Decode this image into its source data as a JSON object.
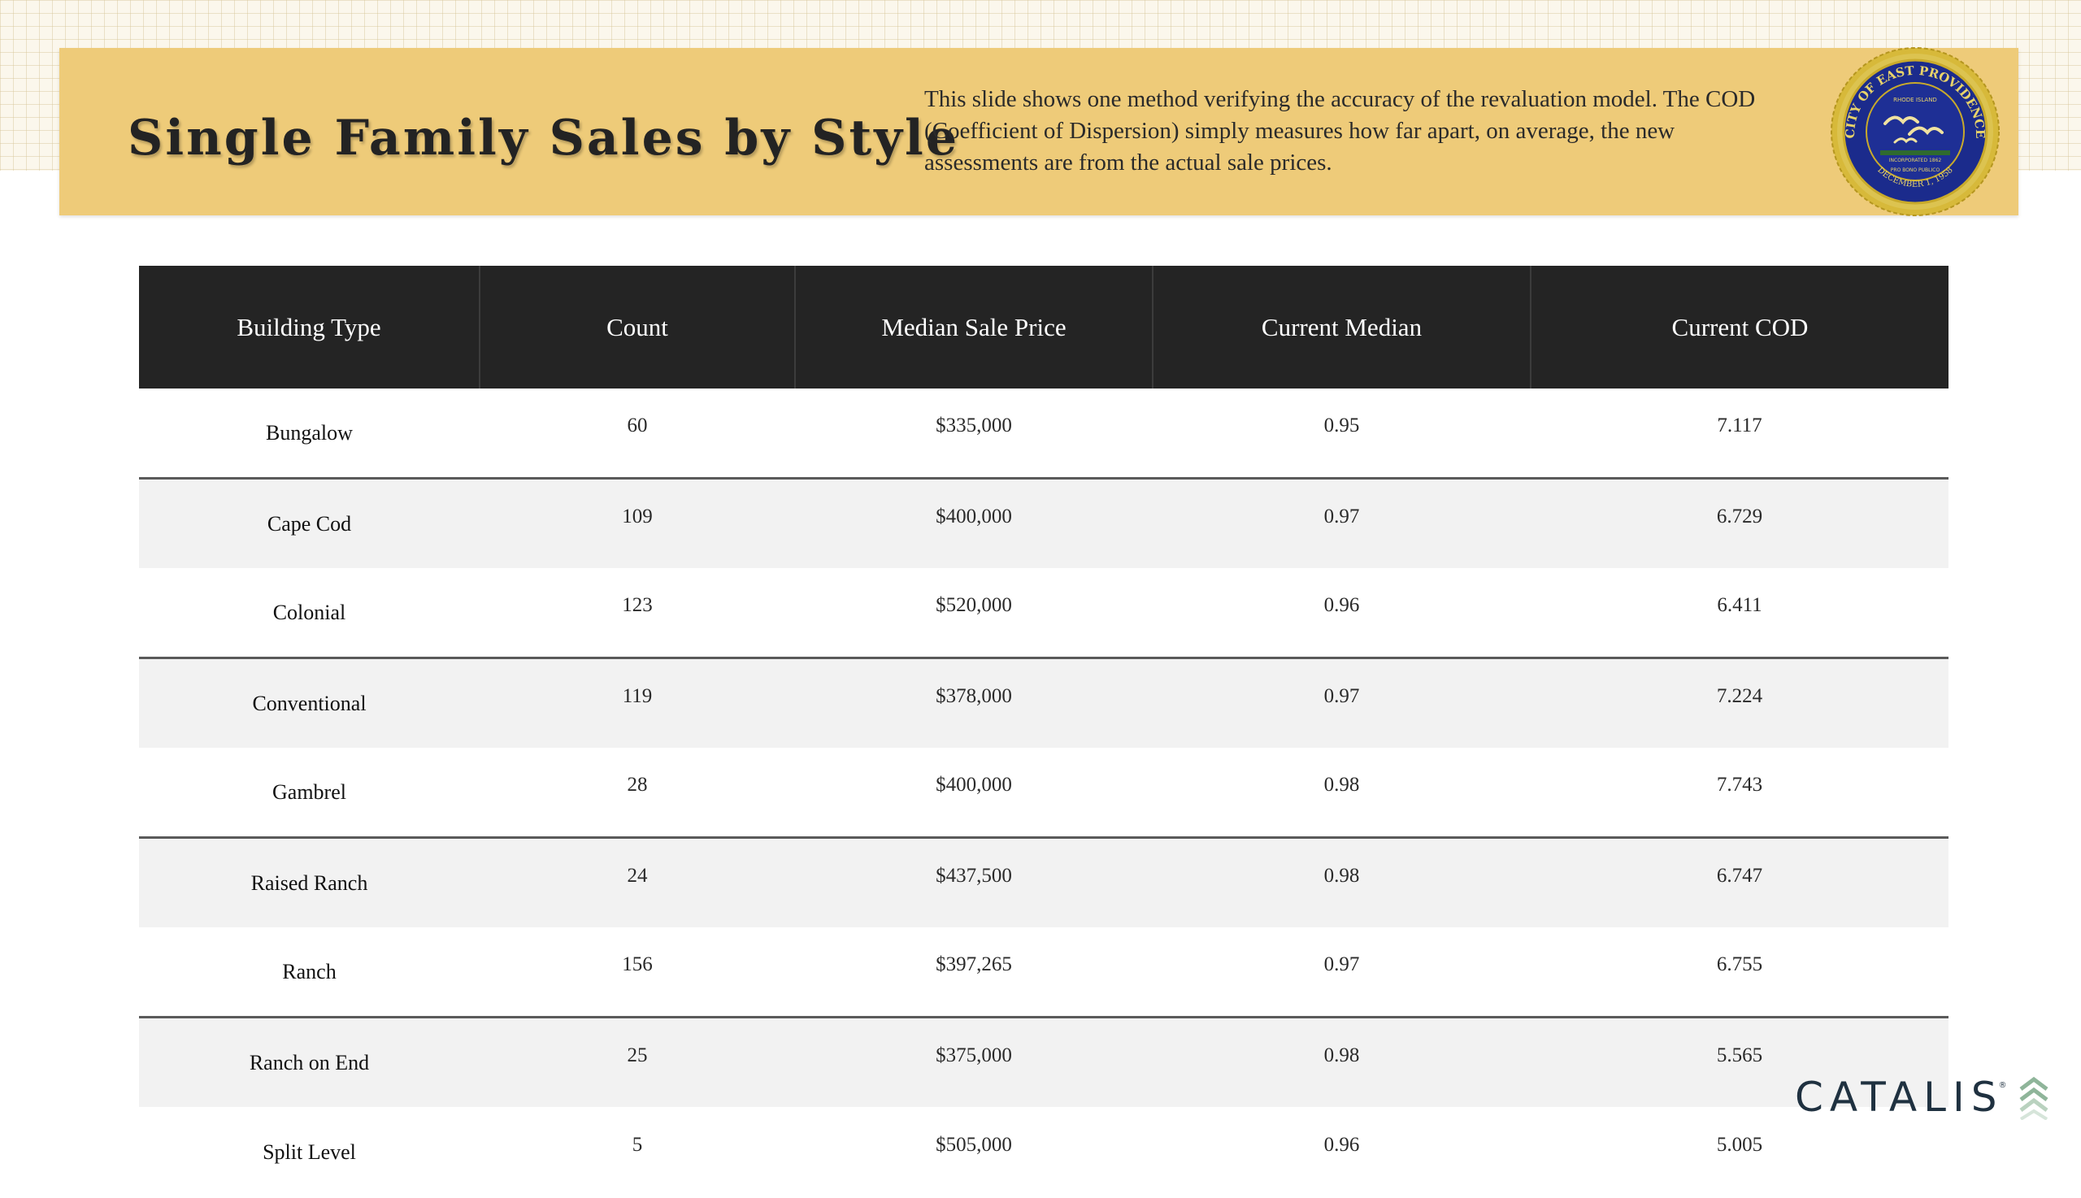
{
  "header": {
    "title": "Single Family Sales by Style",
    "description": "This slide shows one method verifying the accuracy of the revaluation model. The COD (Coefficient of Dispersion) simply measures how far apart, on average, the new assessments are from the actual sale prices."
  },
  "seal": {
    "ring_text": "CITY OF EAST PROVIDENCE",
    "state_text": "RHODE ISLAND",
    "incorporated_text": "INCORPORATED 1862",
    "motto_text": "PRO BONO PUBLICO",
    "date_text": "DECEMBER 1, 1958",
    "colors": {
      "navy": "#1b2b8c",
      "gold": "#d7b93a",
      "green": "#2f6a2f"
    }
  },
  "table": {
    "headers": [
      "Building Type",
      "Count",
      "Median Sale Price",
      "Current Median",
      "Current COD"
    ],
    "rows": [
      [
        "Bungalow",
        "60",
        "$335,000",
        "0.95",
        "7.117"
      ],
      [
        "Cape Cod",
        "109",
        "$400,000",
        "0.97",
        "6.729"
      ],
      [
        "Colonial",
        "123",
        "$520,000",
        "0.96",
        "6.411"
      ],
      [
        "Conventional",
        "119",
        "$378,000",
        "0.97",
        "7.224"
      ],
      [
        "Gambrel",
        "28",
        "$400,000",
        "0.98",
        "7.743"
      ],
      [
        "Raised Ranch",
        "24",
        "$437,500",
        "0.98",
        "6.747"
      ],
      [
        "Ranch",
        "156",
        "$397,265",
        "0.97",
        "6.755"
      ],
      [
        "Ranch on End",
        "25",
        "$375,000",
        "0.98",
        "5.565"
      ],
      [
        "Split Level",
        "5",
        "$505,000",
        "0.96",
        "5.005"
      ]
    ]
  },
  "logo": {
    "text": "CATALIS",
    "registered": "®",
    "icon": "chevrons-up-icon",
    "colors": {
      "text": "#1f3140",
      "mark": "#8fb59a"
    }
  },
  "colors": {
    "banner": "#eecb79",
    "table_header": "#242424",
    "row_alt": "#f2f2f2"
  }
}
